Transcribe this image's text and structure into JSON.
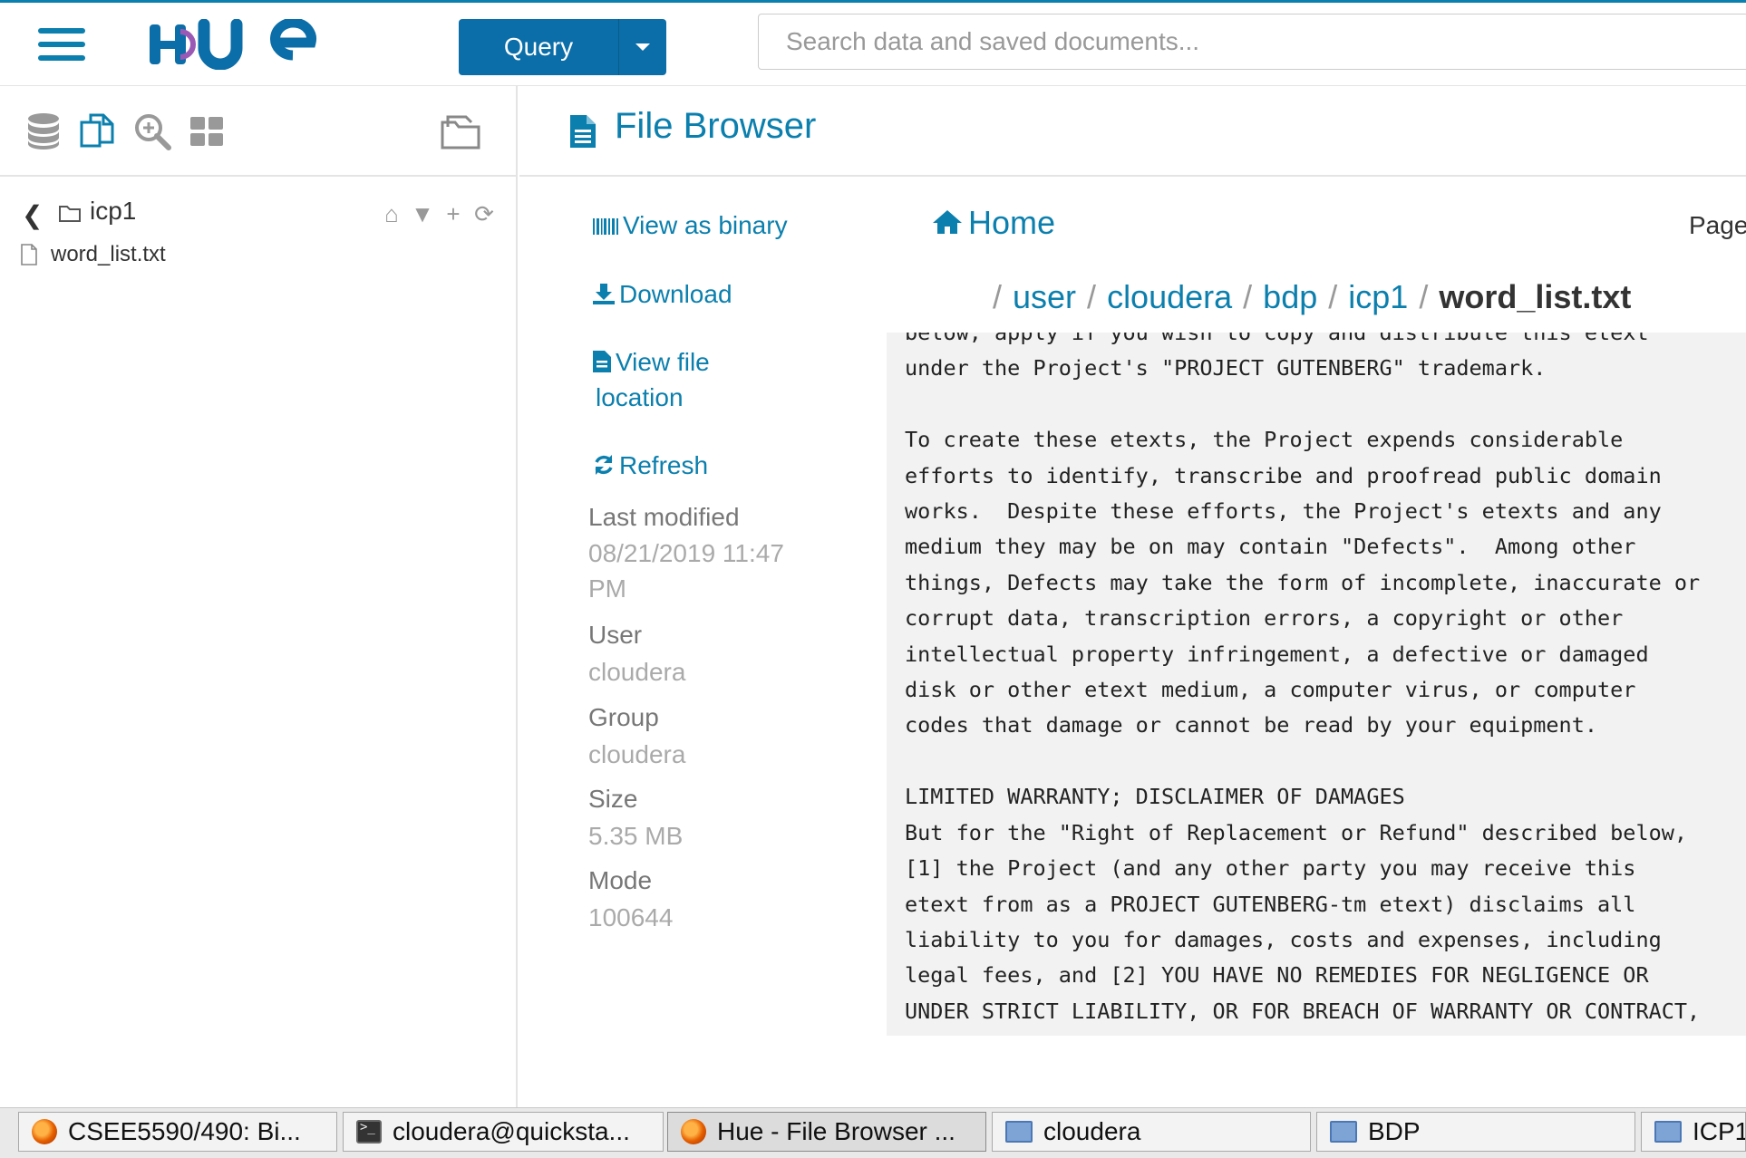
{
  "navbar": {
    "query_label": "Query",
    "search_placeholder": "Search data and saved documents..."
  },
  "sidebar": {
    "folder_name": "icp1",
    "files": [
      "word_list.txt"
    ]
  },
  "main": {
    "title": "File Browser",
    "actions": {
      "view_binary": "View as binary",
      "download": "Download",
      "view_location_1": "View file",
      "view_location_2": "location",
      "refresh": "Refresh"
    },
    "meta": {
      "last_modified_label": "Last modified",
      "last_modified_1": "08/21/2019 11:47",
      "last_modified_2": "PM",
      "user_label": "User",
      "user": "cloudera",
      "group_label": "Group",
      "group": "cloudera",
      "size_label": "Size",
      "size": "5.35 MB",
      "mode_label": "Mode",
      "mode": "100644"
    },
    "home_label": "Home",
    "page_label": "Page",
    "breadcrumb": {
      "user": "user",
      "cloudera": "cloudera",
      "bdp": "bdp",
      "icp1": "icp1",
      "file": "word_list.txt"
    },
    "file_content": "below, apply if you wish to copy and distribute this etext\nunder the Project's \"PROJECT GUTENBERG\" trademark.\n\nTo create these etexts, the Project expends considerable\nefforts to identify, transcribe and proofread public domain\nworks.  Despite these efforts, the Project's etexts and any\nmedium they may be on may contain \"Defects\".  Among other\nthings, Defects may take the form of incomplete, inaccurate or\ncorrupt data, transcription errors, a copyright or other\nintellectual property infringement, a defective or damaged\ndisk or other etext medium, a computer virus, or computer\ncodes that damage or cannot be read by your equipment.\n\nLIMITED WARRANTY; DISCLAIMER OF DAMAGES\nBut for the \"Right of Replacement or Refund\" described below,\n[1] the Project (and any other party you may receive this\netext from as a PROJECT GUTENBERG-tm etext) disclaims all\nliability to you for damages, costs and expenses, including\nlegal fees, and [2] YOU HAVE NO REMEDIES FOR NEGLIGENCE OR\nUNDER STRICT LIABILITY, OR FOR BREACH OF WARRANTY OR CONTRACT,"
  },
  "taskbar": {
    "items": [
      "CSEE5590/490: Bi...",
      "cloudera@quicksta...",
      "Hue - File Browser ...",
      "cloudera",
      "BDP",
      "ICP1"
    ]
  },
  "colors": {
    "accent": "#0b7fad",
    "query_button": "#0b6ea8"
  }
}
